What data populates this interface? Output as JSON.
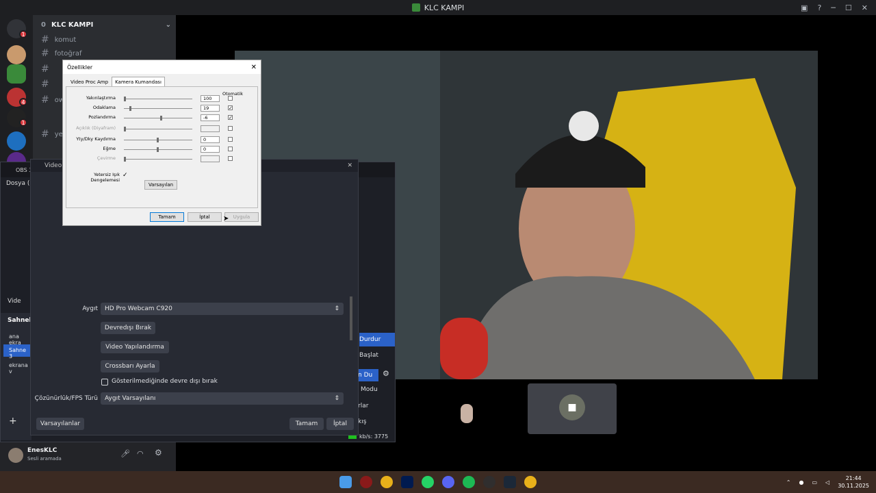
{
  "window": {
    "title": "KLC KAMPI"
  },
  "discord": {
    "server_name": "KLC KAMPI",
    "server_level": "0",
    "guild_badges": [
      "1",
      "4",
      "1"
    ],
    "channels": [
      {
        "icon": "#",
        "label": "komut"
      },
      {
        "icon": "#",
        "label": "fotoğraf"
      },
      {
        "icon": "#",
        "label": ""
      },
      {
        "icon": "#",
        "label": ""
      },
      {
        "icon": "#",
        "label": "ow"
      },
      {
        "icon": "#",
        "label": "yet"
      }
    ],
    "user": {
      "name": "EnesKLC",
      "status": "Sesli aramada"
    }
  },
  "obs": {
    "main_title": "OBS 3",
    "menu_file": "Dosya (F",
    "source_label": "Vide",
    "scenes_header": "Sahnele",
    "scenes": [
      "ana ekra",
      "Sahne 3",
      "ekrana v"
    ],
    "controls": [
      "Durdur",
      "Başlat",
      "n Du",
      "Modu",
      "rlar",
      "kış"
    ],
    "status": "kb/s: 3775",
    "dialog": {
      "title": "Video Y",
      "device_label": "Aygıt",
      "device_value": "HD Pro Webcam C920",
      "btn_deactivate": "Devredışı Bırak",
      "btn_video_config": "Video Yapılandırma",
      "btn_crossbar": "Crossbarı Ayarla",
      "checkbox_label": "Gösterilmediğinde devre dışı bırak",
      "res_label": "Çözünürlük/FPS Türü",
      "res_value": "Aygıt Varsayılanı",
      "btn_defaults": "Varsayılanlar",
      "btn_ok": "Tamam",
      "btn_cancel": "İptal"
    }
  },
  "props": {
    "title": "Özellikler",
    "tabs": [
      "Video Proc Amp",
      "Kamera Kumandası"
    ],
    "auto_header": "Otomatik",
    "rows": [
      {
        "label": "Yakınlaştırma",
        "value": "100",
        "auto": false,
        "disabled": false,
        "pos": 0.0
      },
      {
        "label": "Odaklama",
        "value": "19",
        "auto": true,
        "disabled": false,
        "pos": 0.08
      },
      {
        "label": "Pozlandırma",
        "value": "-6",
        "auto": true,
        "disabled": false,
        "pos": 0.55
      },
      {
        "label": "Açıklık (Diyafram)",
        "value": "",
        "auto": false,
        "disabled": true,
        "pos": 0.0
      },
      {
        "label": "Yty/Dky Kaydırma",
        "value": "0",
        "auto": false,
        "disabled": false,
        "pos": 0.5
      },
      {
        "label": "Eğme",
        "value": "0",
        "auto": false,
        "disabled": false,
        "pos": 0.5
      },
      {
        "label": "Çevirme",
        "value": "",
        "auto": false,
        "disabled": true,
        "pos": 0.0
      }
    ],
    "low_light_label": "Yetersiz Işık Dengelemesi",
    "low_light_checked": true,
    "btn_defaults": "Varsayılan",
    "btn_ok": "Tamam",
    "btn_cancel": "İptal",
    "btn_apply": "Uygula"
  },
  "taskbar": {
    "time": "21:44",
    "date": "30.11.2025"
  }
}
